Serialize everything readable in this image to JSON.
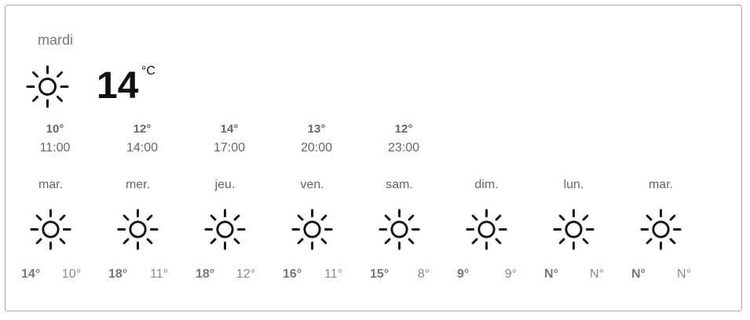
{
  "current": {
    "day": "mardi",
    "temp": "14",
    "unit": "°C",
    "icon": "sun-icon"
  },
  "hourly": [
    {
      "temp": "10°",
      "time": "11:00"
    },
    {
      "temp": "12°",
      "time": "14:00"
    },
    {
      "temp": "14°",
      "time": "17:00"
    },
    {
      "temp": "13°",
      "time": "20:00"
    },
    {
      "temp": "12°",
      "time": "23:00"
    }
  ],
  "forecast": [
    {
      "day": "mar.",
      "high": "14°",
      "low": "10°",
      "icon": "sun-icon"
    },
    {
      "day": "mer.",
      "high": "18°",
      "low": "11°",
      "icon": "sun-icon"
    },
    {
      "day": "jeu.",
      "high": "18°",
      "low": "12°",
      "icon": "sun-icon"
    },
    {
      "day": "ven.",
      "high": "16°",
      "low": "11°",
      "icon": "sun-icon"
    },
    {
      "day": "sam.",
      "high": "15°",
      "low": "8°",
      "icon": "sun-icon"
    },
    {
      "day": "dim.",
      "high": "9°",
      "low": "9°",
      "icon": "sun-icon"
    },
    {
      "day": "lun.",
      "high": "N°",
      "low": "N°",
      "icon": "sun-icon"
    },
    {
      "day": "mar.",
      "high": "N°",
      "low": "N°",
      "icon": "sun-icon"
    }
  ]
}
